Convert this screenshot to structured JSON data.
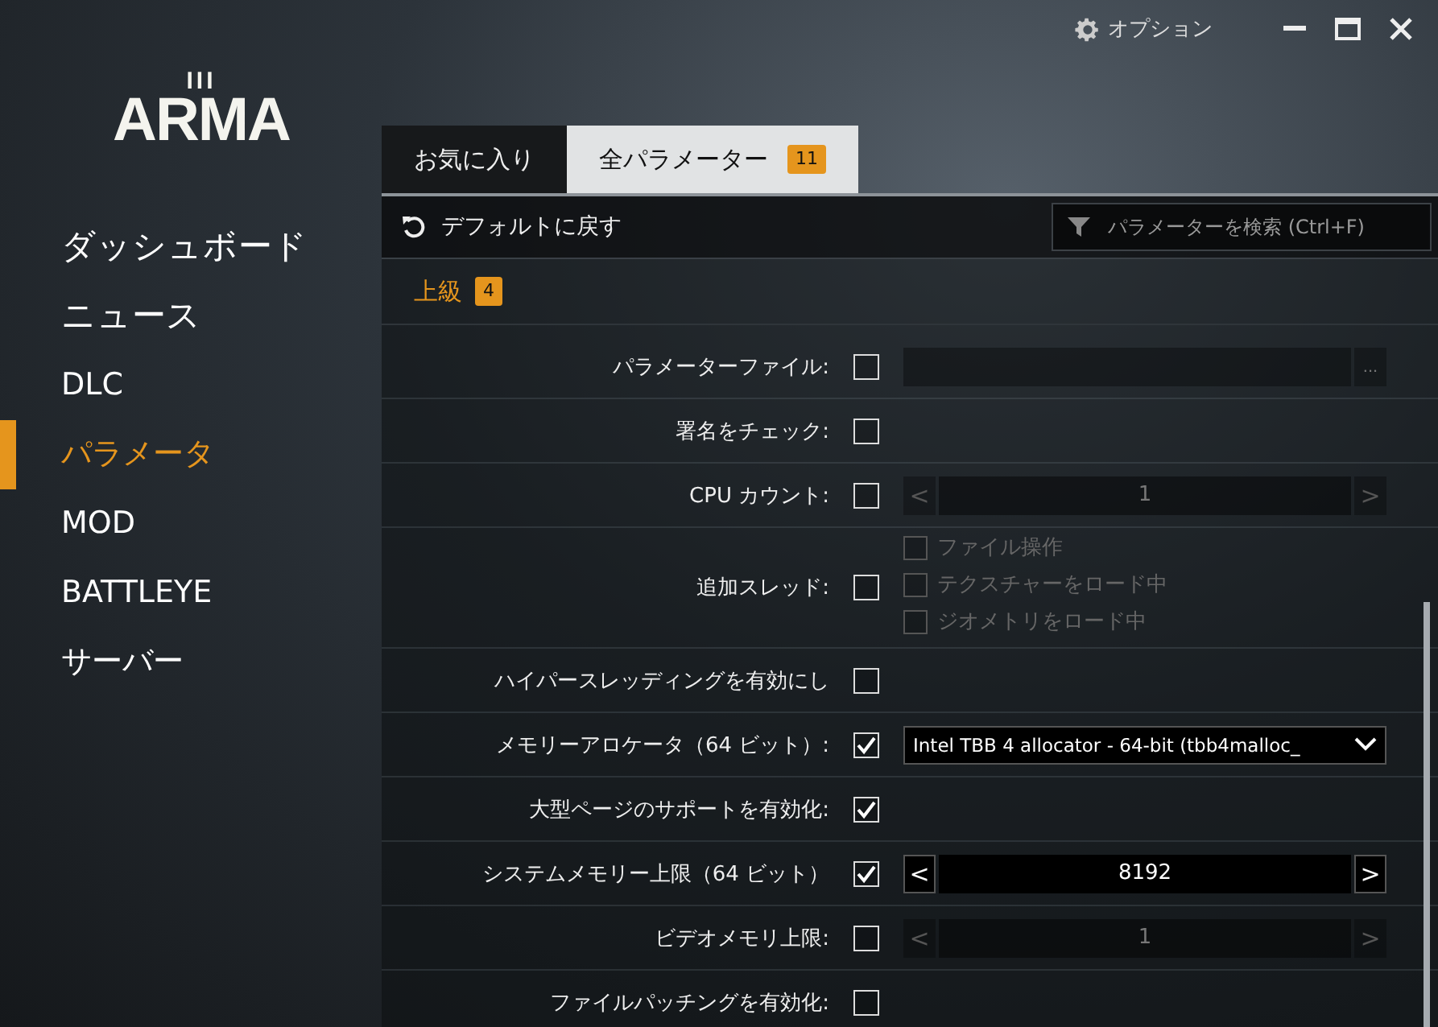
{
  "logo": {
    "word": "ARMA",
    "numeral": "III"
  },
  "top_bar": {
    "options_label": "オプション"
  },
  "sidebar": {
    "items": [
      {
        "label": "ダッシュボード",
        "selected": false
      },
      {
        "label": "ニュース",
        "selected": false
      },
      {
        "label": "DLC",
        "selected": false
      },
      {
        "label": "パラメータ",
        "selected": true
      },
      {
        "label": "MOD",
        "selected": false
      },
      {
        "label": "BATTLEYE",
        "selected": false
      },
      {
        "label": "サーバー",
        "selected": false
      }
    ]
  },
  "tabs": [
    {
      "label": "お気に入り",
      "selected": false
    },
    {
      "label": "全パラメーター",
      "badge": "11",
      "selected": true
    }
  ],
  "toolbar": {
    "reset_label": "デフォルトに戻す",
    "search": {
      "placeholder": "パラメーターを検索 (Ctrl+F)"
    }
  },
  "section": {
    "title": "上級",
    "count": "4"
  },
  "rows": [
    {
      "kind": "file",
      "label": "パラメーターファイル:",
      "checked": false,
      "button": "..."
    },
    {
      "kind": "plain",
      "label": "署名をチェック:",
      "checked": false
    },
    {
      "kind": "stepper",
      "label": "CPU カウント:",
      "checked": false,
      "value": "1",
      "prev": "<",
      "next": ">"
    },
    {
      "kind": "options",
      "label": "追加スレッド:",
      "checked": false,
      "options": [
        {
          "label": "ファイル操作",
          "checked": false
        },
        {
          "label": "テクスチャーをロード中",
          "checked": false
        },
        {
          "label": "ジオメトリをロード中",
          "checked": false
        }
      ]
    },
    {
      "kind": "plain",
      "label": "ハイパースレッディングを有効にし",
      "checked": false
    },
    {
      "kind": "dropdown",
      "label": "メモリーアロケータ（64 ビット）:",
      "checked": true,
      "value": "Intel TBB 4 allocator - 64-bit (tbb4malloc_"
    },
    {
      "kind": "plain",
      "label": "大型ページのサポートを有効化:",
      "checked": true
    },
    {
      "kind": "stepper",
      "label": "システムメモリー上限（64 ビット）",
      "checked": true,
      "value": "8192",
      "prev": "<",
      "next": ">"
    },
    {
      "kind": "stepper",
      "label": "ビデオメモリ上限:",
      "checked": false,
      "value": "1",
      "prev": "<",
      "next": ">"
    },
    {
      "kind": "plain",
      "label": "ファイルパッチングを有効化:",
      "checked": false
    }
  ]
}
